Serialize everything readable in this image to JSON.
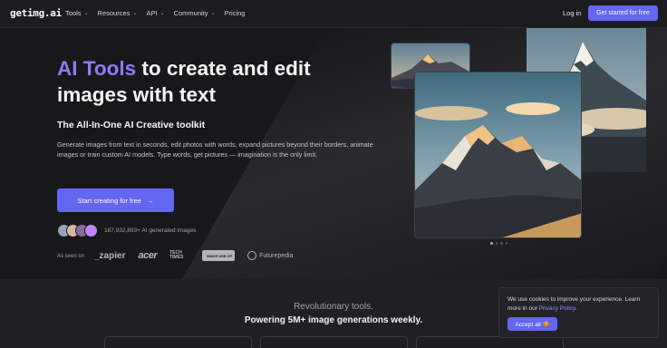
{
  "nav": {
    "logo": "getimg.ai",
    "links": [
      {
        "label": "Tools",
        "has_dropdown": true
      },
      {
        "label": "Resources",
        "has_dropdown": true
      },
      {
        "label": "API",
        "has_dropdown": true
      },
      {
        "label": "Community",
        "has_dropdown": true
      },
      {
        "label": "Pricing",
        "has_dropdown": false
      }
    ],
    "login": "Log in",
    "cta": "Get started for free",
    "chevron_icon": "chevron-down-icon"
  },
  "hero": {
    "headline_accent": "AI Tools",
    "headline_rest": " to create and edit images with text",
    "subhead": "The All-In-One AI Creative toolkit",
    "description": "Generate images from text in seconds, edit photos with words, expand pictures beyond their borders, animate images or train custom AI models. Type words, get pictures — imagination is the only limit.",
    "cta": "Start creating for free",
    "cta_icon": "arrow-right-icon",
    "generated_count": "187,932,893+ AI generated images",
    "as_seen_on": "As seen on",
    "brands": [
      "_zapier",
      "acer",
      "TECH TIMES",
      "MAKE USE OF",
      "Futurepedia"
    ]
  },
  "carousel": {
    "slides": 4,
    "active": 0
  },
  "lower": {
    "line1": "Revolutionary tools.",
    "line2": "Powering 5M+ image generations weekly."
  },
  "cookie": {
    "text": "We use cookies to improve your experience. Learn more in our ",
    "link": "Privacy Policy",
    "end": ".",
    "button": "Accept all 🍪"
  },
  "colors": {
    "accent": "#6366f1",
    "headline_accent": "#8b7cf6",
    "bg": "#18181b"
  }
}
